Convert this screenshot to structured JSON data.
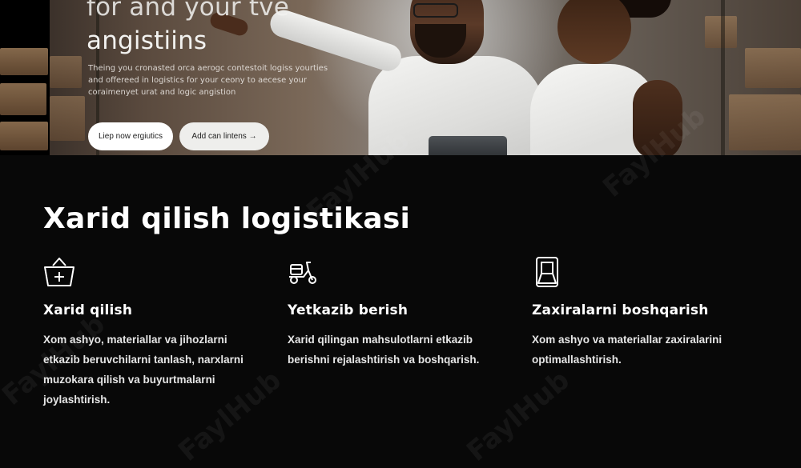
{
  "hero": {
    "title_line1": "for and your tve",
    "title_line2": "angistiins",
    "description": "Theing you cronasted orca aerogc contestoit logiss yourties and offereed in logistics for your ceony to aecese your coraimenyet urat and logic angistion",
    "primary_button": "Liep now ergiutics",
    "secondary_button": "Add can lintens →"
  },
  "section": {
    "title": "Xarid qilish logistikasi",
    "cards": [
      {
        "icon": "shopping-basket-icon",
        "title": "Xarid qilish",
        "text": "Xom ashyo, materiallar va jihozlarni etkazib beruvchilarni tanlash, narxlarni muzokara qilish va buyurtmalarni joylashtirish."
      },
      {
        "icon": "delivery-scooter-icon",
        "title": "Yetkazib berish",
        "text": "Xarid qilingan mahsulotlarni etkazib berishni rejalashtirish va boshqarish."
      },
      {
        "icon": "warehouse-storage-icon",
        "title": "Zaxiralarni boshqarish",
        "text": "Xom ashyo va materiallar zaxiralarini optimallashtirish."
      }
    ]
  },
  "watermark": "FaylHub",
  "colors": {
    "background": "#080808",
    "text": "#ffffff",
    "button": "#ffffff"
  }
}
